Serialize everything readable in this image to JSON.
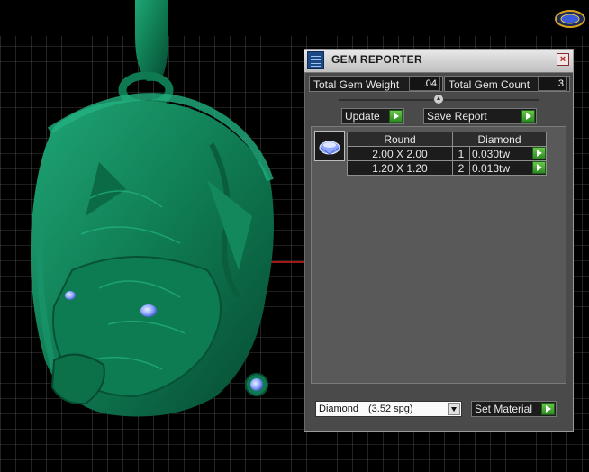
{
  "panel": {
    "title": "GEM REPORTER",
    "close_label": "×",
    "total_gem_weight_label": "Total Gem Weight",
    "total_gem_weight_value": ".04",
    "total_gem_count_label": "Total Gem Count",
    "total_gem_count_value": "3",
    "update_label": "Update",
    "save_report_label": "Save Report",
    "table": {
      "headers": [
        "Round",
        "Diamond"
      ],
      "rows": [
        {
          "size": "2.00 X 2.00",
          "count": "1",
          "weight": "0.030tw"
        },
        {
          "size": "1.20 X 1.20",
          "count": "2",
          "weight": "0.013tw"
        }
      ]
    },
    "material_select": {
      "value": "Diamond",
      "spg": "(3.52 spg)"
    },
    "set_material_label": "Set Material"
  },
  "icons": {
    "logo": "logo-icon",
    "app": "gem-reporter-icon",
    "gem": "round-gem-icon",
    "play": "play-arrow-icon",
    "dropdown": "chevron-down-icon"
  },
  "colors": {
    "model": "#0f7a52",
    "grid": "#6e6e6e",
    "play_button": "#3ea02c",
    "gem": "#8fa8ff"
  }
}
